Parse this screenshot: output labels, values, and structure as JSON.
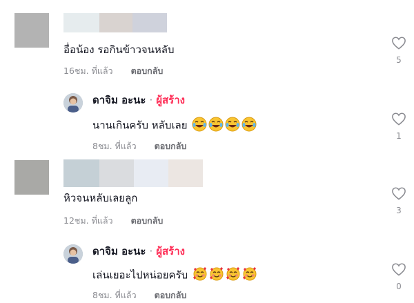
{
  "threads": [
    {
      "comment": {
        "avatar_color": "#b3b3b3",
        "name_block_colors": [
          "#e6ecee",
          "#d9d3d0",
          "#cfd2dc"
        ],
        "text": "อื่อน้อง รอกินข้าวจนหลับ",
        "time": "16ชม. ที่แล้ว",
        "reply_label": "ตอบกลับ",
        "likes": "5"
      },
      "reply": {
        "author": "ดาจิม อะนะ",
        "separator": "·",
        "creator_tag": "ผู้สร้าง",
        "text": "นานเกินครับ หลับเลย",
        "emoji": "laughing-tears-face",
        "emoji_count": 4,
        "time": "8ชม. ที่แล้ว",
        "reply_label": "ตอบกลับ",
        "likes": "1"
      }
    },
    {
      "comment": {
        "avatar_color": "#a9a9a6",
        "name_block_colors": [
          "#c5d0d6",
          "#dadcdf",
          "#e8ecf3",
          "#ece6e2"
        ],
        "text": "หิวจนหลับเลยลูก",
        "time": "12ชม. ที่แล้ว",
        "reply_label": "ตอบกลับ",
        "likes": "3"
      },
      "reply": {
        "author": "ดาจิม อะนะ",
        "separator": "·",
        "creator_tag": "ผู้สร้าง",
        "text": "เล่นเยอะไปหน่อยครับ",
        "emoji": "smiling-face-with-hearts",
        "emoji_count": 4,
        "time": "8ชม. ที่แล้ว",
        "reply_label": "ตอบกลับ",
        "likes": "0"
      }
    }
  ],
  "colors": {
    "creator_tag": "#fe2c55",
    "meta": "#8a8b91",
    "text": "#161823"
  }
}
